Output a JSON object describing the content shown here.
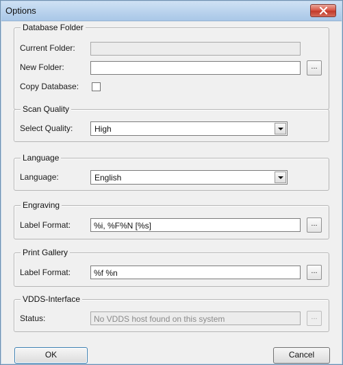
{
  "window": {
    "title": "Options"
  },
  "database_folder": {
    "legend": "Database Folder",
    "current_folder_label": "Current Folder:",
    "current_folder_value": "",
    "new_folder_label": "New Folder:",
    "new_folder_value": "",
    "browse_label": "...",
    "copy_database_label": "Copy Database:",
    "copy_database_checked": false
  },
  "scan_quality": {
    "legend": "Scan Quality",
    "select_label": "Select Quality:",
    "selected_value": "High"
  },
  "language": {
    "legend": "Language",
    "label": "Language:",
    "selected_value": "English"
  },
  "engraving": {
    "legend": "Engraving",
    "label_format_label": "Label Format:",
    "label_format_value": "%i, %F%N [%s]",
    "browse_label": "..."
  },
  "print_gallery": {
    "legend": "Print Gallery",
    "label_format_label": "Label Format:",
    "label_format_value": "%f %n",
    "browse_label": "..."
  },
  "vdds_interface": {
    "legend": "VDDS-Interface",
    "status_label": "Status:",
    "status_value": "No VDDS host found on this system",
    "browse_label": "..."
  },
  "footer": {
    "ok_label": "OK",
    "cancel_label": "Cancel"
  },
  "colors": {
    "title_bar": "#b7d1ec",
    "close_button": "#d9594a",
    "dialog_background": "#f0f0f0"
  }
}
